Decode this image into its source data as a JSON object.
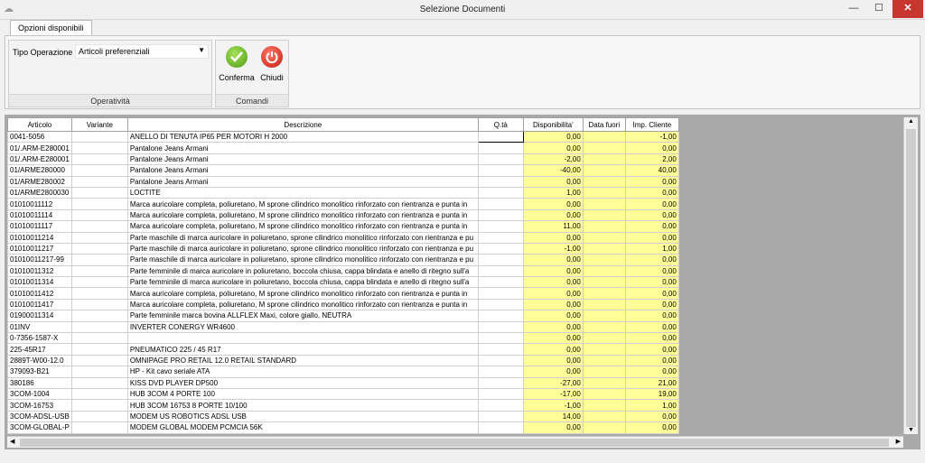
{
  "window": {
    "title": "Selezione Documenti",
    "minimize": "—",
    "maximize": "☐",
    "close": "✕"
  },
  "tab": {
    "label": "Opzioni disponibili"
  },
  "operativita": {
    "group_label": "Operatività",
    "tipo_label": "Tipo Operazione",
    "tipo_value": "Articoli preferenziali"
  },
  "comandi": {
    "group_label": "Comandi",
    "confirm_label": "Conferma",
    "close_label": "Chiudi"
  },
  "grid": {
    "columns": [
      "Articolo",
      "Variante",
      "Descrizione",
      "Q.tà",
      "Disponibilita'",
      "Data fuori",
      "Imp. Cliente"
    ],
    "rows": [
      [
        "0041-5056",
        "",
        "ANELLO DI TENUTA IP65 PER MOTORI H 2000",
        "",
        "0,00",
        "",
        "-1,00"
      ],
      [
        "01/.ARM-E280001",
        "",
        "Pantalone Jeans Armani",
        "",
        "0,00",
        "",
        "0,00"
      ],
      [
        "01/.ARM-E280001",
        "",
        "Pantalone Jeans Armani",
        "",
        "-2,00",
        "",
        "2,00"
      ],
      [
        "01/ARME280000",
        "",
        "Pantalone Jeans Armani",
        "",
        "-40,00",
        "",
        "40,00"
      ],
      [
        "01/ARME280002",
        "",
        "Pantalone Jeans Armani",
        "",
        "0,00",
        "",
        "0,00"
      ],
      [
        "01/ARME2800030",
        "",
        "LOCTITE",
        "",
        "1,00",
        "",
        "0,00"
      ],
      [
        "01010011112",
        "",
        "Marca auricolare completa, poliuretano, M sprone cilindrico monolitico rinforzato con rientranza e punta in",
        "",
        "0,00",
        "",
        "0,00"
      ],
      [
        "01010011114",
        "",
        "Marca auricolare completa, poliuretano, M sprone cilindrico monolitico rinforzato con rientranza e punta in",
        "",
        "0,00",
        "",
        "0,00"
      ],
      [
        "01010011117",
        "",
        "Marca auricolare completa, poliuretano, M sprone cilindrico monolitico rinforzato con rientranza e punta in",
        "",
        "11,00",
        "",
        "0,00"
      ],
      [
        "01010011214",
        "",
        "Parte maschile di marca auricolare in poliuretano, sprone cilindrico monolitico rinforzato con rientranza e pu",
        "",
        "0,00",
        "",
        "0,00"
      ],
      [
        "01010011217",
        "",
        "Parte maschile di marca auricolare in poliuretano, sprone cilindrico monolitico rinforzato con rientranza e pu",
        "",
        "-1,00",
        "",
        "1,00"
      ],
      [
        "01010011217-99",
        "",
        "Parte maschile di marca auricolare in poliuretano, sprone cilindrico monolitico rinforzato con rientranza e pu",
        "",
        "0,00",
        "",
        "0,00"
      ],
      [
        "01010011312",
        "",
        "Parte femminile di marca auricolare in poliuretano, boccola chiusa, cappa blindata e anello di ritegno sull'a",
        "",
        "0,00",
        "",
        "0,00"
      ],
      [
        "01010011314",
        "",
        "Parte femminile di marca auricolare in poliuretano, boccola chiusa, cappa blindata e anello di ritegno sull'a",
        "",
        "0,00",
        "",
        "0,00"
      ],
      [
        "01010011412",
        "",
        "Marca auricolare completa, poliuretano, M sprone cilindrico monolitico rinforzato con rientranza e punta in",
        "",
        "0,00",
        "",
        "0,00"
      ],
      [
        "01010011417",
        "",
        "Marca auricolare completa, poliuretano, M sprone cilindrico monolitico rinforzato con rientranza e punta in",
        "",
        "0,00",
        "",
        "0,00"
      ],
      [
        "01900011314",
        "",
        "Parte femminile marca bovina ALLFLEX Maxi, colore giallo, NEUTRA",
        "",
        "0,00",
        "",
        "0,00"
      ],
      [
        "01INV",
        "",
        "INVERTER CONERGY WR4600",
        "",
        "0,00",
        "",
        "0,00"
      ],
      [
        "0-7356-1587-X",
        "",
        "",
        "",
        "0,00",
        "",
        "0,00"
      ],
      [
        "225-45R17",
        "",
        "PNEUMATICO 225 / 45 R17",
        "",
        "0,00",
        "",
        "0,00"
      ],
      [
        "2889T-W00-12.0",
        "",
        "OMNIPAGE PRO RETAIL 12.0 RETAIL STANDARD",
        "",
        "0,00",
        "",
        "0,00"
      ],
      [
        "379093-B21",
        "",
        "HP - Kit cavo seriale ATA",
        "",
        "0,00",
        "",
        "0,00"
      ],
      [
        "380186",
        "",
        "KISS DVD PLAYER DP500",
        "",
        "-27,00",
        "",
        "21,00"
      ],
      [
        "3COM-1004",
        "",
        "HUB 3COM 4 PORTE 100",
        "",
        "-17,00",
        "",
        "19,00"
      ],
      [
        "3COM-16753",
        "",
        "HUB 3COM 16753 8  PORTE 10/100",
        "",
        "-1,00",
        "",
        "1,00"
      ],
      [
        "3COM-ADSL-USB",
        "",
        "MODEM US ROBOTICS ADSL USB",
        "",
        "14,00",
        "",
        "0,00"
      ],
      [
        "3COM-GLOBAL-P",
        "",
        "MODEM GLOBAL MODEM PCMCIA 56K",
        "",
        "0,00",
        "",
        "0,00"
      ]
    ]
  },
  "colors": {
    "available_bg": "#ffff99",
    "close_button": "#c7372f"
  }
}
